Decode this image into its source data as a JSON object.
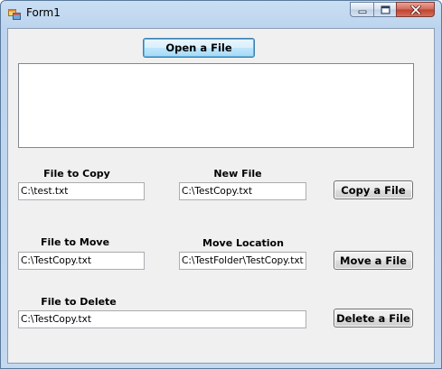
{
  "window": {
    "title": "Form1",
    "icon": "winforms-app-icon",
    "controls": [
      "minimize-icon",
      "maximize-icon",
      "close-icon"
    ]
  },
  "open_button": {
    "label": "Open a File"
  },
  "copy": {
    "source_label": "File to Copy",
    "source_value": "C:\\test.txt",
    "dest_label": "New File",
    "dest_value": "C:\\TestCopy.txt",
    "button_label": "Copy a File"
  },
  "move": {
    "source_label": "File to Move",
    "source_value": "C:\\TestCopy.txt",
    "dest_label": "Move Location",
    "dest_value": "C:\\TestFolder\\TestCopy.txt",
    "button_label": "Move a File"
  },
  "delete": {
    "source_label": "File to Delete",
    "source_value": "C:\\TestCopy.txt",
    "button_label": "Delete a File"
  },
  "colors": {
    "titlebar": "#c4d9f0",
    "client": "#f0f0f0",
    "close_button": "#c0402f",
    "focused_button_border": "#3c7fb1"
  }
}
